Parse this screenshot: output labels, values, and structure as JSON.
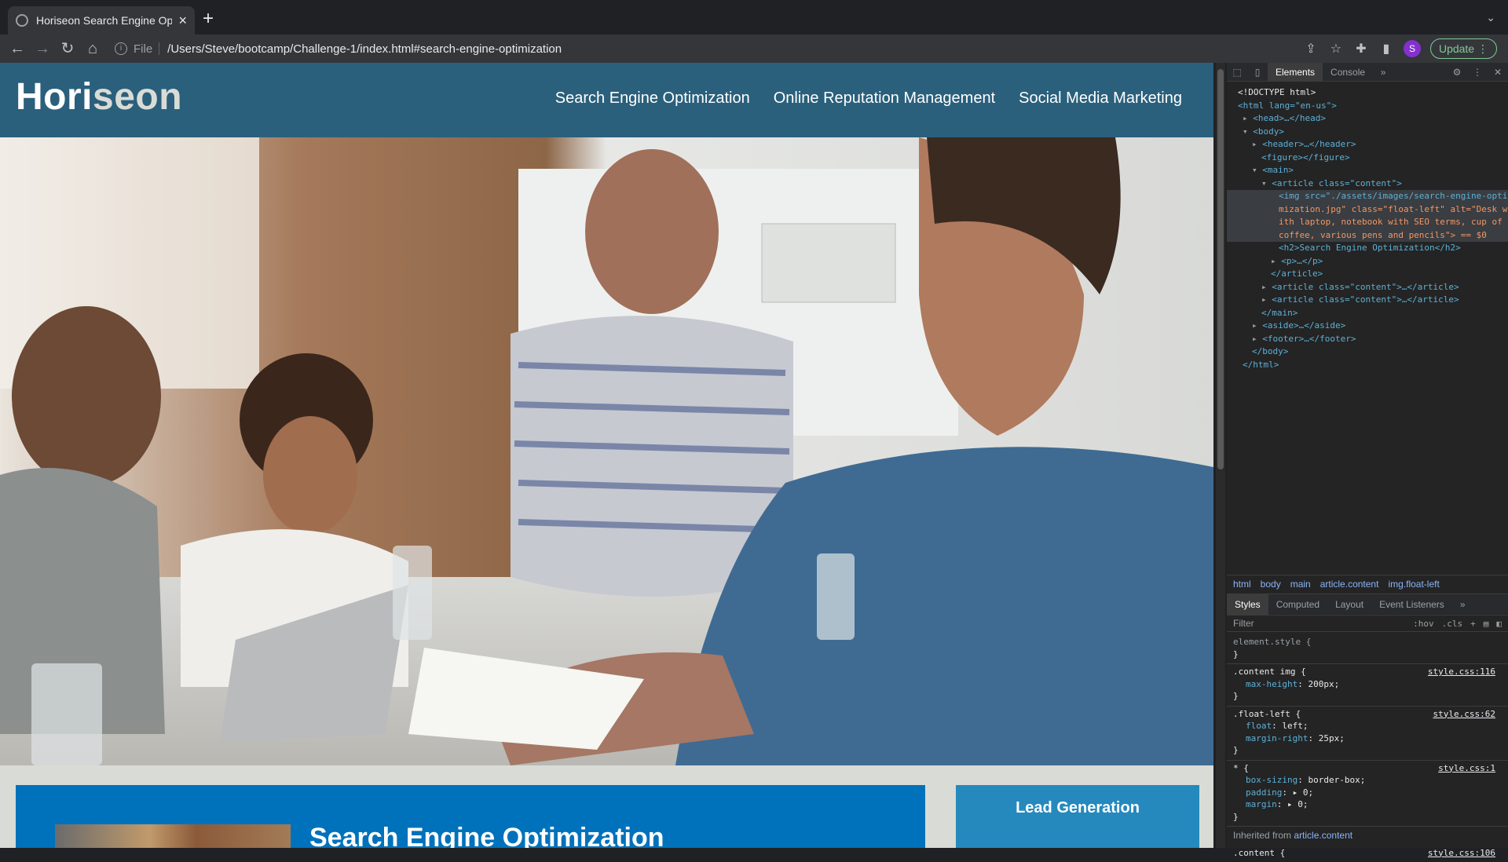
{
  "browser": {
    "tab_title": "Horiseon Search Engine Optim",
    "url_scheme": "File",
    "url": "/Users/Steve/bootcamp/Challenge-1/index.html#search-engine-optimization",
    "avatar_initial": "S",
    "update_label": "Update"
  },
  "site": {
    "logo_main": "Hori",
    "logo_rest": "seon",
    "nav": [
      "Search Engine Optimization",
      "Online Reputation Management",
      "Social Media Marketing"
    ],
    "section_heading": "Search Engine Optimization",
    "benefit_heading": "Lead Generation"
  },
  "devtools": {
    "tabs": [
      "Elements",
      "Console"
    ],
    "dom": {
      "doctype": "<!DOCTYPE html>",
      "html_open": "<html lang=\"en-us\">",
      "head": "<head>…</head>",
      "body_open": "<body>",
      "header": "<header>…</header>",
      "figure": "<figure></figure>",
      "main_open": "<main>",
      "article_open": "<article class=\"content\">",
      "img_line1": "<img src=\"./assets/images/search-engine-opti",
      "img_line2": "mization.jpg\" class=\"float-left\" alt=\"Desk w",
      "img_line3": "ith laptop, notebook with SEO terms, cup of",
      "img_line4": "coffee, various pens and pencils\"> == $0",
      "h2": "<h2>Search Engine Optimization</h2>",
      "p": "<p>…</p>",
      "article_close": "</article>",
      "article2": "<article class=\"content\">…</article>",
      "article3": "<article class=\"content\">…</article>",
      "main_close": "</main>",
      "aside": "<aside>…</aside>",
      "footer": "<footer>…</footer>",
      "body_close": "</body>",
      "html_close": "</html>"
    },
    "breadcrumbs": [
      "html",
      "body",
      "main",
      "article.content",
      "img.float-left"
    ],
    "style_tabs": [
      "Styles",
      "Computed",
      "Layout",
      "Event Listeners"
    ],
    "filter_placeholder": "Filter",
    "hov": ":hov",
    "cls": ".cls",
    "rules": [
      {
        "selector": "element.style {",
        "source": "",
        "props": []
      },
      {
        "selector": ".content img {",
        "source": "style.css:116",
        "props": [
          [
            "max-height",
            "200px;"
          ]
        ]
      },
      {
        "selector": ".float-left {",
        "source": "style.css:62",
        "props": [
          [
            "float",
            "left;"
          ],
          [
            "margin-right",
            "25px;"
          ]
        ]
      },
      {
        "selector": "* {",
        "source": "style.css:1",
        "props": [
          [
            "box-sizing",
            "border-box;"
          ],
          [
            "padding",
            "▸ 0;"
          ],
          [
            "margin",
            "▸ 0;"
          ]
        ]
      }
    ],
    "inherited_label": "Inherited from",
    "inherited_from": "article.content",
    "last_selector": ".content {",
    "last_source": "style.css:106"
  }
}
